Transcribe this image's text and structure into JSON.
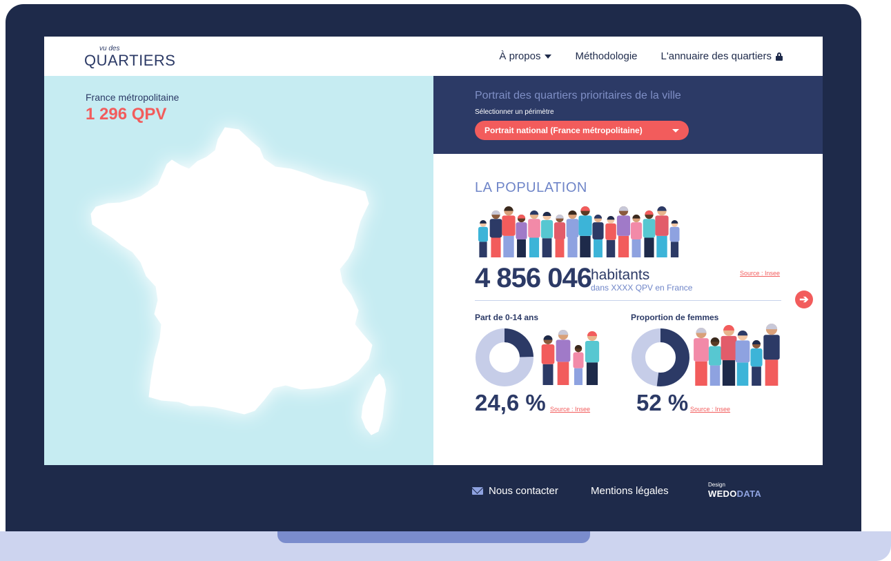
{
  "logo": {
    "small": "vu des",
    "big": "QUARTIERS"
  },
  "nav": {
    "about": "À propos",
    "methodology": "Méthodologie",
    "directory": "L'annuaire des quartiers"
  },
  "map": {
    "region_label": "France métropolitaine",
    "qpv_count": "1 296 QPV"
  },
  "selector": {
    "title": "Portrait des quartiers prioritaires de la ville",
    "label": "Sélectionner un périmètre",
    "value": "Portrait national (France métropolitaine)"
  },
  "population": {
    "title": "LA POPULATION",
    "number": "4 856 046",
    "unit": "habitants",
    "subtitle": "dans XXXX QPV en France",
    "source": "Source : Insee",
    "next_icon": "arrow-right-icon"
  },
  "stats": [
    {
      "label": "Part de 0-14 ans",
      "value": "24,6 %",
      "fraction": 0.246,
      "source": "Source : Insee"
    },
    {
      "label": "Proportion de femmes",
      "value": "52 %",
      "fraction": 0.52,
      "source": "Source : Insee"
    }
  ],
  "footer": {
    "contact": "Nous contacter",
    "legal": "Mentions légales",
    "design_label": "Design",
    "design_brand_1": "WEDO",
    "design_brand_2": "DATA"
  },
  "colors": {
    "navy": "#1e2a4a",
    "accent": "#f25c5c",
    "map_bg": "#c6ecf2",
    "light_blue": "#6f85c8",
    "donut_light": "#c6cde8"
  }
}
